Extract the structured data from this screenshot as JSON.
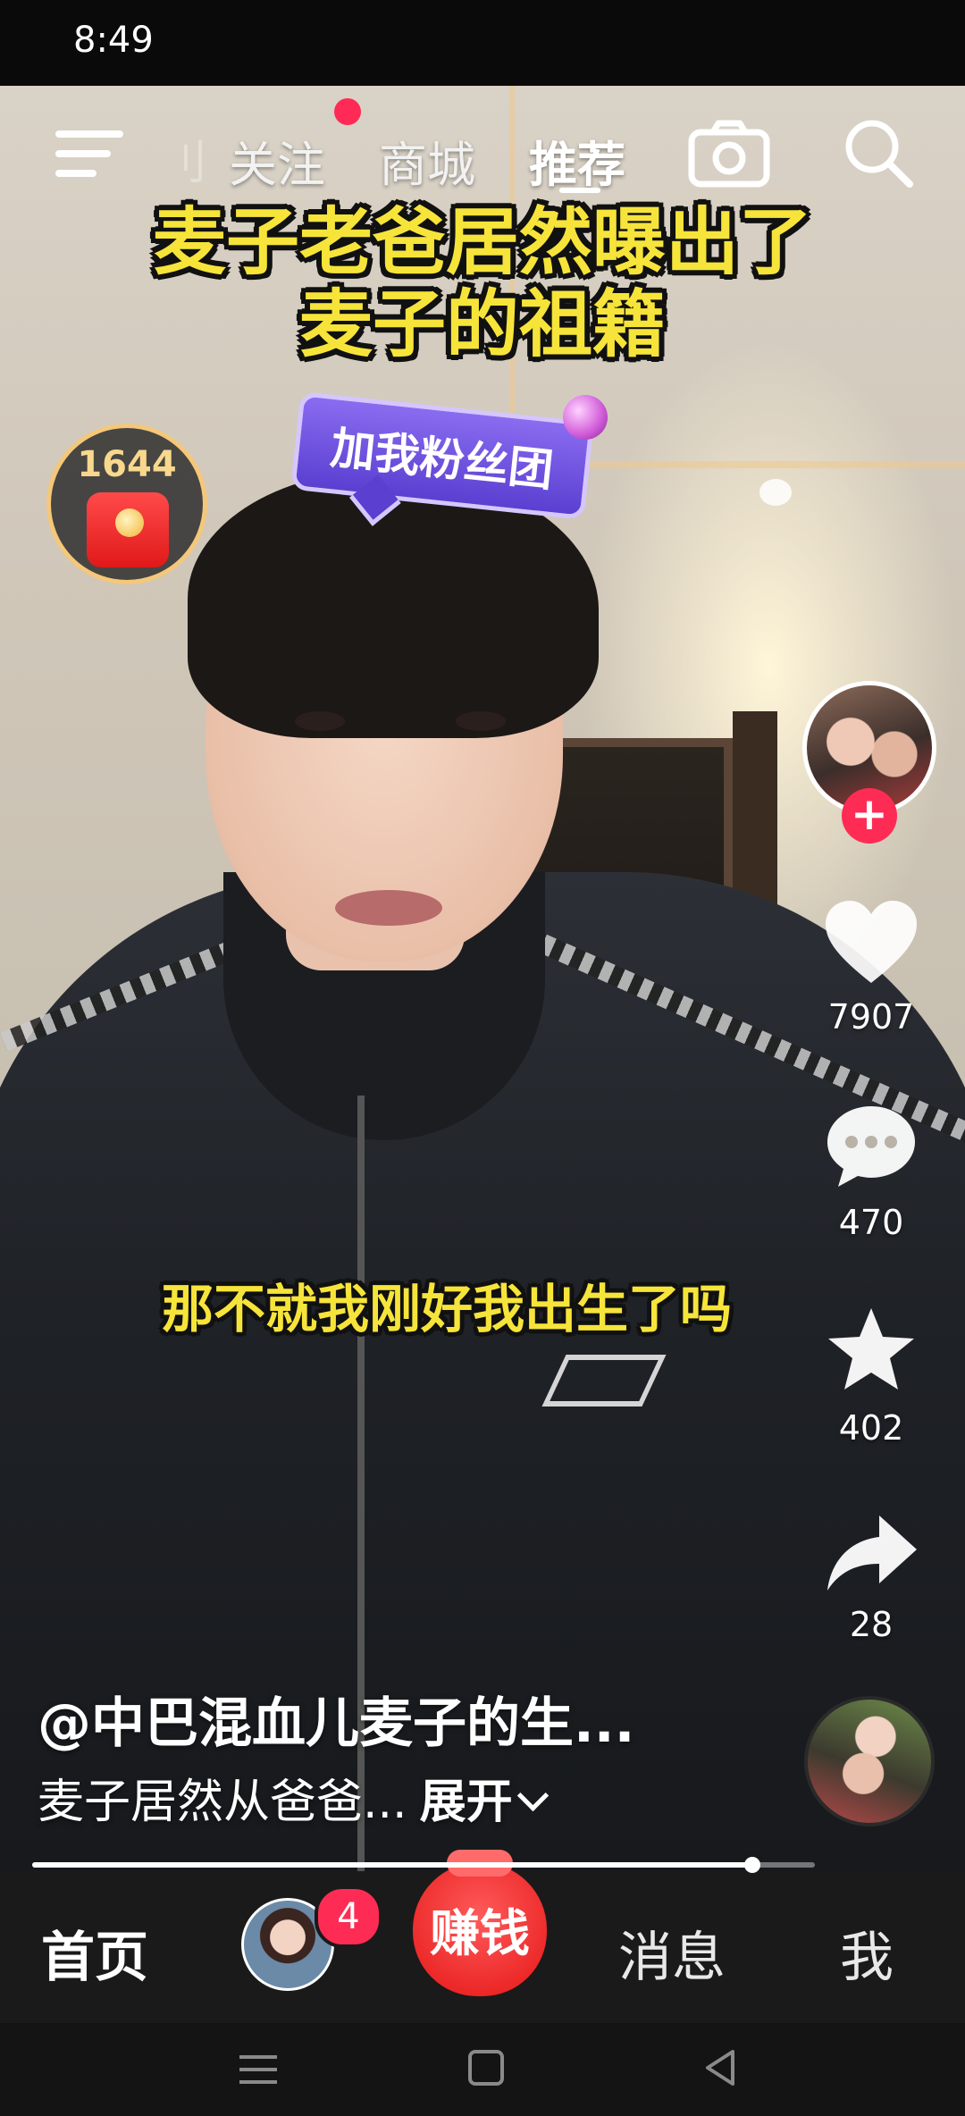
{
  "status_bar": {
    "time": "8:49"
  },
  "top_nav": {
    "ghost_tab": "刂",
    "tabs": [
      {
        "label": "关注",
        "active": false,
        "has_dot": true
      },
      {
        "label": "商城",
        "active": false
      },
      {
        "label": "推荐",
        "active": true
      }
    ],
    "icons": [
      "menu-icon",
      "camera-icon",
      "search-icon"
    ]
  },
  "video": {
    "title_caption_line1": "麦子老爸居然曝出了",
    "title_caption_line2": "麦子的祖籍",
    "sticker_text": "加我粉丝团",
    "subtitle": "那不就我刚好我出生了吗"
  },
  "red_packet": {
    "count": "1644"
  },
  "right_rail": {
    "follow_symbol": "+",
    "likes": "7907",
    "comments": "470",
    "favorites": "402",
    "shares": "28"
  },
  "post": {
    "author": "@中巴混血儿麦子的生...",
    "description": "麦子居然从爸爸...",
    "expand_label": "展开"
  },
  "playback": {
    "progress": 0.92
  },
  "bottom_tabs": {
    "home": "首页",
    "friend_badge": "4",
    "earn": "赚钱",
    "messages": "消息",
    "me": "我"
  },
  "colors": {
    "accent": "#fe2c55",
    "caption_yellow": "#f6e43a",
    "tabbar_bg": "#1a1a1a"
  }
}
